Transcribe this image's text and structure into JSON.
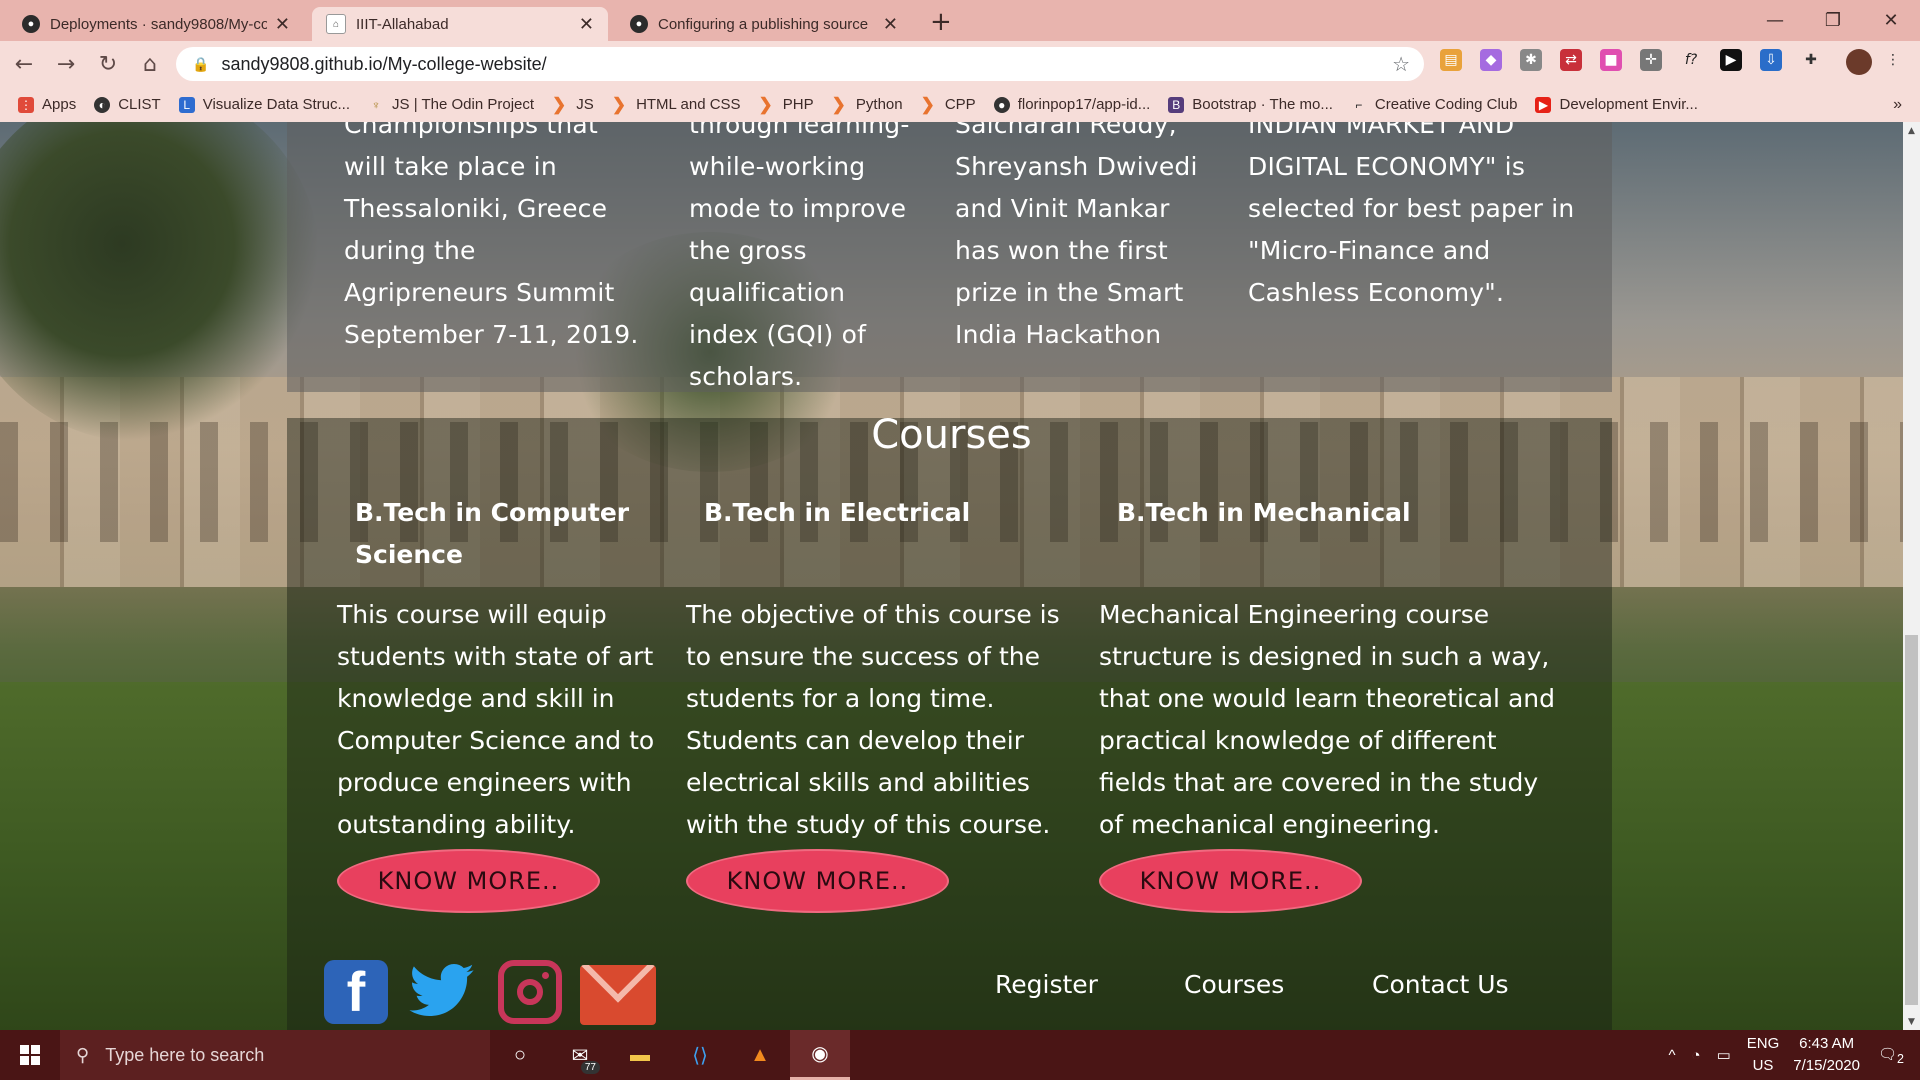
{
  "browser": {
    "tabs": [
      {
        "title": "Deployments · sandy9808/My-co",
        "active": false,
        "icon": "github-icon"
      },
      {
        "title": "IIIT-Allahabad",
        "active": true,
        "icon": "iiit-favicon"
      },
      {
        "title": "Configuring a publishing source",
        "active": false,
        "icon": "github-icon"
      }
    ],
    "new_tab_symbol": "+",
    "url": "sandy9808.github.io/My-college-website/",
    "bookmarks": [
      {
        "label": "Apps",
        "icon": "apps-grid-icon"
      },
      {
        "label": "CLIST",
        "icon": "clist-icon"
      },
      {
        "label": "Visualize Data Struc...",
        "icon": "l-icon"
      },
      {
        "label": "JS | The Odin Project",
        "icon": "odin-icon"
      },
      {
        "label": "JS",
        "icon": "chevron-bookmark-icon"
      },
      {
        "label": "HTML and CSS",
        "icon": "chevron-bookmark-icon"
      },
      {
        "label": "PHP",
        "icon": "chevron-bookmark-icon"
      },
      {
        "label": "Python",
        "icon": "chevron-bookmark-icon"
      },
      {
        "label": "CPP",
        "icon": "chevron-bookmark-icon"
      },
      {
        "label": "florinpop17/app-id...",
        "icon": "github-icon"
      },
      {
        "label": "Bootstrap · The mo...",
        "icon": "bootstrap-icon"
      },
      {
        "label": "Creative Coding Club",
        "icon": "ccc-icon"
      },
      {
        "label": "Development Envir...",
        "icon": "youtube-icon"
      }
    ],
    "bookmarks_more": "»"
  },
  "achievements": [
    "Championships that will take place in Thessaloniki, Greece during the Agripreneurs Summit September 7-11, 2019.",
    "through learning-while-working mode to improve the gross qualification index (GQI) of scholars.",
    "Saicharan Reddy, Shreyansh Dwivedi and Vinit Mankar has won the first prize in the Smart India Hackathon",
    "INDIAN MARKET AND DIGITAL ECONOMY\" is selected for best paper in \"Micro-Finance and Cashless Economy\"."
  ],
  "courses": {
    "title": "Courses",
    "items": [
      {
        "heading": "B.Tech in Computer Science",
        "description": "This course will equip students with state of art knowledge and skill in Computer Science and to produce engineers with outstanding ability.",
        "button": "KNOW MORE.."
      },
      {
        "heading": "B.Tech in Electrical",
        "description": "The objective of this course is to ensure the success of the students for a long time. Students can develop their electrical skills and abilities with the study of this course.",
        "button": "KNOW MORE.."
      },
      {
        "heading": "B.Tech in Mechanical",
        "description": "Mechanical Engineering course structure is designed in such a way, that one would learn theoretical and practical knowledge of different fields that are covered in the study of mechanical engineering.",
        "button": "KNOW MORE.."
      }
    ]
  },
  "footer": {
    "social": [
      "facebook-icon",
      "twitter-icon",
      "instagram-icon",
      "email-icon"
    ],
    "links": [
      "Register",
      "Courses",
      "Contact Us"
    ]
  },
  "taskbar": {
    "search_placeholder": "Type here to search",
    "mail_badge": "77",
    "language": "ENG",
    "region": "US",
    "time": "6:43 AM",
    "date": "7/15/2020",
    "notifications": "2"
  },
  "colors": {
    "tabbar": "#e8b4ae",
    "toolbar": "#f6ddd9",
    "taskbar": "#4a1515",
    "know_more_button": "#e8405e"
  }
}
